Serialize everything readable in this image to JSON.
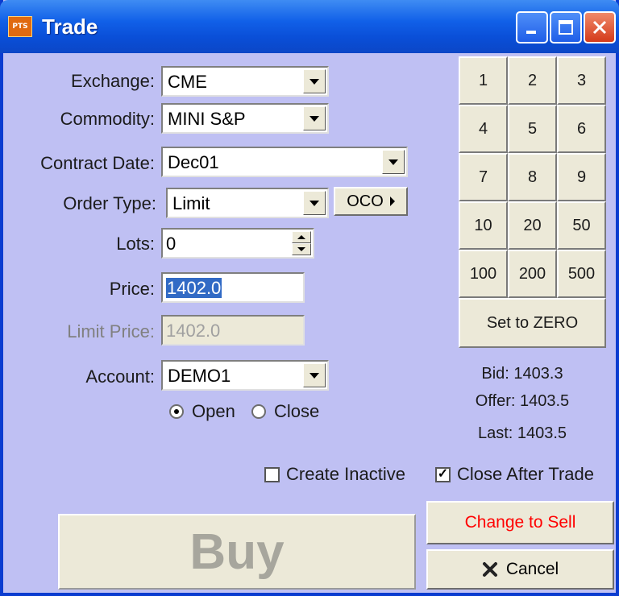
{
  "window": {
    "title": "Trade",
    "icon_text": "PTS"
  },
  "form": {
    "exchange": {
      "label": "Exchange:",
      "value": "CME"
    },
    "commodity": {
      "label": "Commodity:",
      "value": "MINI S&P"
    },
    "contract_date": {
      "label": "Contract Date:",
      "value": "Dec01"
    },
    "order_type": {
      "label": "Order Type:",
      "value": "Limit",
      "oco_label": "OCO"
    },
    "lots": {
      "label": "Lots:",
      "value": "0"
    },
    "price": {
      "label": "Price:",
      "value": "1402.0"
    },
    "limit_price": {
      "label": "Limit Price:",
      "value": "1402.0"
    },
    "account": {
      "label": "Account:",
      "value": "DEMO1"
    },
    "open_label": "Open",
    "close_label": "Close",
    "selected_position": "Open"
  },
  "keypad": {
    "keys": [
      "1",
      "2",
      "3",
      "4",
      "5",
      "6",
      "7",
      "8",
      "9",
      "10",
      "20",
      "50",
      "100",
      "200",
      "500"
    ],
    "zero_label": "Set to ZERO"
  },
  "quote": {
    "bid": "Bid: 1403.3",
    "offer": "Offer: 1403.5",
    "last": "Last: 1403.5"
  },
  "options": {
    "create_inactive": {
      "label": "Create Inactive",
      "checked": false
    },
    "close_after_trade": {
      "label": "Close After Trade",
      "checked": true
    }
  },
  "actions": {
    "buy_label": "Buy",
    "change_label": "Change to Sell",
    "change_color": "#ff0000",
    "cancel_label": "Cancel"
  }
}
